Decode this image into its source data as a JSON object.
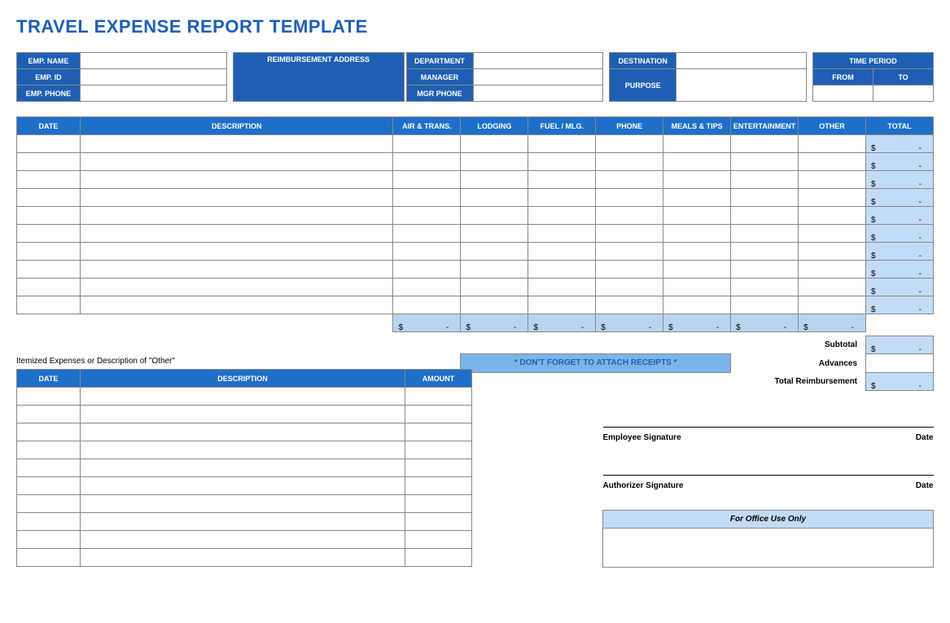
{
  "title": "TRAVEL EXPENSE REPORT TEMPLATE",
  "header": {
    "emp_name": "EMP. NAME",
    "emp_id": "EMP. ID",
    "emp_phone": "EMP. PHONE",
    "reimb_addr": "REIMBURSEMENT ADDRESS",
    "department": "DEPARTMENT",
    "manager": "MANAGER",
    "mgr_phone": "MGR PHONE",
    "destination": "DESTINATION",
    "purpose": "PURPOSE",
    "time_period": "TIME PERIOD",
    "from": "FROM",
    "to": "TO"
  },
  "grid": {
    "cols": {
      "date": "DATE",
      "desc": "DESCRIPTION",
      "air": "AIR & TRANS.",
      "lodging": "LODGING",
      "fuel": "FUEL / MLG.",
      "phone": "PHONE",
      "meals": "MEALS & TIPS",
      "ent": "ENTERTAINMENT",
      "other": "OTHER",
      "total": "TOTAL"
    },
    "total_sym": "$",
    "total_dash": "-"
  },
  "summary": {
    "subtotal": "Subtotal",
    "advances": "Advances",
    "total_reimb": "Total Reimbursement"
  },
  "receipts": "* DON'T FORGET TO ATTACH RECEIPTS *",
  "other_section": {
    "title": "Itemized Expenses or Description of \"Other\"",
    "date": "DATE",
    "desc": "DESCRIPTION",
    "amount": "AMOUNT"
  },
  "signatures": {
    "emp": "Employee Signature",
    "auth": "Authorizer Signature",
    "date": "Date"
  },
  "office": "For Office Use Only"
}
